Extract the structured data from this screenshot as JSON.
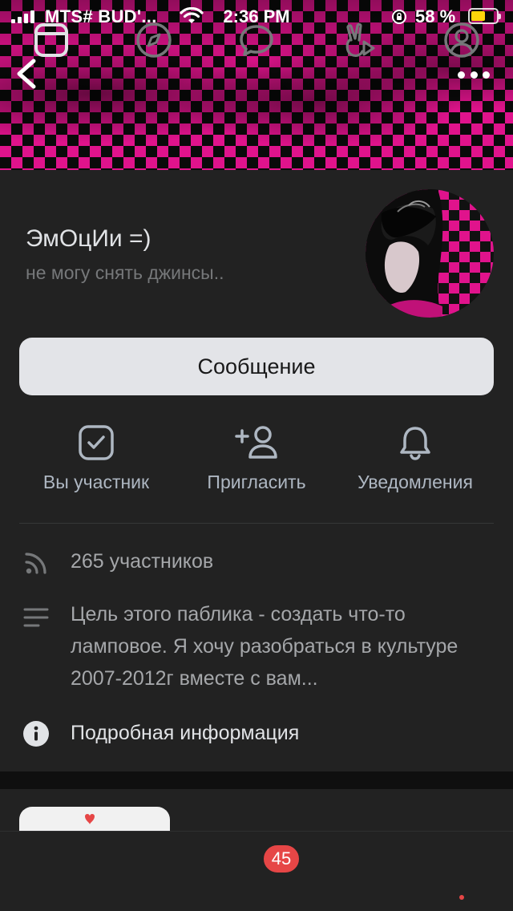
{
  "status_bar": {
    "carrier": "MTS# BUD'...",
    "time": "2:36 PM",
    "battery_percent": "58 %",
    "battery_level": 0.58,
    "icons": [
      "signal-icon",
      "wifi-icon",
      "orientation-lock-icon",
      "battery-icon"
    ]
  },
  "nav": {
    "back_icon": "chevron-left-icon",
    "more_icon": "more-horizontal-icon"
  },
  "group": {
    "name": "ЭмОцИи =)",
    "status": "не могу снять джинсы.."
  },
  "message_button": {
    "label": "Сообщение"
  },
  "actions": [
    {
      "label": "Вы участник",
      "icon": "checkbox-checked-icon"
    },
    {
      "label": "Пригласить",
      "icon": "add-user-icon"
    },
    {
      "label": "Уведомления",
      "icon": "bell-icon"
    }
  ],
  "info": {
    "members": "265 участников",
    "description": "Цель этого паблика - создать что-то ламповое. Я хочу разобраться в культуре 2007-2012г вместе с вам...",
    "details": "Подробная информация"
  },
  "tab_bar": {
    "tabs": [
      {
        "icon": "feed-icon",
        "active": true
      },
      {
        "icon": "compass-icon",
        "active": false
      },
      {
        "icon": "messages-icon",
        "active": false
      },
      {
        "icon": "clips-icon",
        "active": false
      },
      {
        "icon": "profile-icon",
        "active": false
      }
    ],
    "messages_badge": "45"
  },
  "colors": {
    "background": "#222222",
    "accent_pink": "#e0138c",
    "badge_red": "#e64646",
    "button_bg": "#e3e4e8"
  }
}
